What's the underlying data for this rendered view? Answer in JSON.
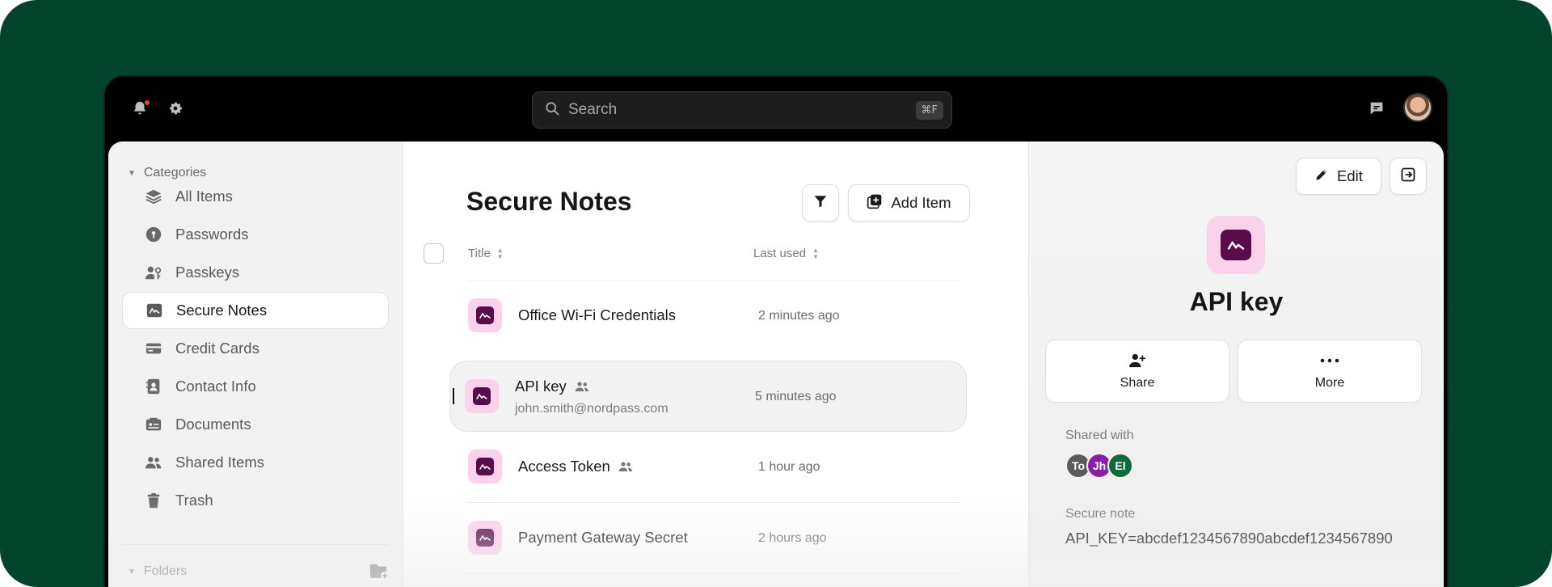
{
  "topbar": {
    "search_placeholder": "Search",
    "search_shortcut": "⌘F",
    "icons": [
      "bell-icon",
      "gear-icon",
      "chat-icon",
      "user-avatar"
    ]
  },
  "sidebar": {
    "categories_label": "Categories",
    "items": [
      {
        "label": "All Items",
        "icon": "layers-icon"
      },
      {
        "label": "Passwords",
        "icon": "key-icon"
      },
      {
        "label": "Passkeys",
        "icon": "passkey-icon"
      },
      {
        "label": "Secure Notes",
        "icon": "note-icon",
        "active": true
      },
      {
        "label": "Credit Cards",
        "icon": "card-icon"
      },
      {
        "label": "Contact Info",
        "icon": "contact-icon"
      },
      {
        "label": "Documents",
        "icon": "document-icon"
      },
      {
        "label": "Shared Items",
        "icon": "people-icon"
      },
      {
        "label": "Trash",
        "icon": "trash-icon"
      }
    ],
    "folders_label": "Folders"
  },
  "list": {
    "title": "Secure Notes",
    "add_label": "Add Item",
    "columns": {
      "title": "Title",
      "last_used": "Last used"
    },
    "rows": [
      {
        "title": "Office Wi-Fi Credentials",
        "subtitle": "",
        "time": "2 minutes ago",
        "shared": false
      },
      {
        "title": "API key",
        "subtitle": "john.smith@nordpass.com",
        "time": "5 minutes ago",
        "shared": true,
        "selected": true
      },
      {
        "title": "Access Token",
        "subtitle": "",
        "time": "1 hour ago",
        "shared": true
      },
      {
        "title": "Payment Gateway Secret",
        "subtitle": "",
        "time": "2 hours ago",
        "shared": false
      }
    ]
  },
  "detail": {
    "edit_label": "Edit",
    "title": "API key",
    "share_label": "Share",
    "more_label": "More",
    "shared_with_label": "Shared with",
    "shared_with": [
      {
        "initials": "To",
        "color": "#5b5b5b"
      },
      {
        "initials": "Jh",
        "color": "#8b1fa3"
      },
      {
        "initials": "El",
        "color": "#0f6a3e"
      }
    ],
    "note_label": "Secure note",
    "note_value": "API_KEY=abcdef1234567890abcdef1234567890"
  },
  "colors": {
    "background": "#01442b",
    "note_icon_bg": "#fbd1ec",
    "note_icon_fg": "#5a0b4a",
    "notification_dot": "#ef3b3b"
  }
}
